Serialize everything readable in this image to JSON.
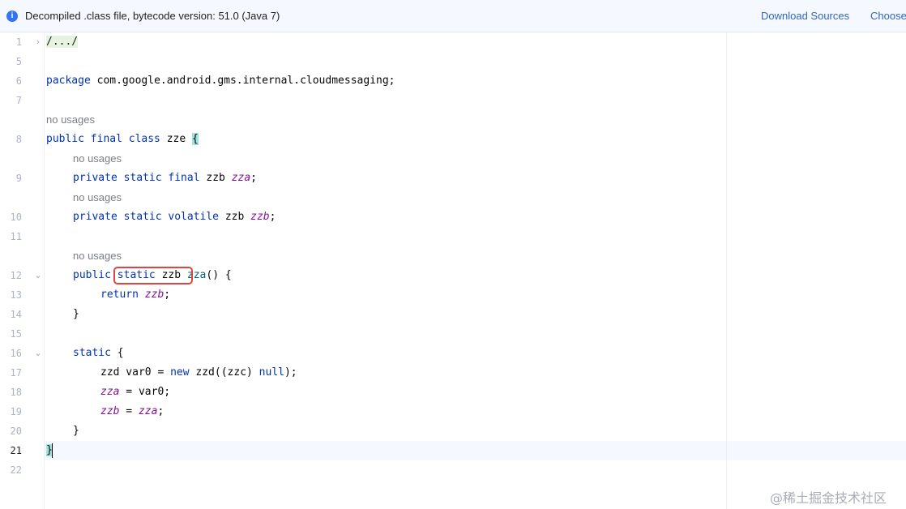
{
  "banner": {
    "icon": "info-icon",
    "message": "Decompiled .class file, bytecode version: 51.0 (Java 7)",
    "download_sources": "Download Sources",
    "choose_sources": "Choose"
  },
  "editor": {
    "line_numbers": [
      "1",
      "5",
      "6",
      "7",
      "8",
      "9",
      "10",
      "11",
      "12",
      "13",
      "14",
      "15",
      "16",
      "17",
      "18",
      "19",
      "20",
      "21",
      "22"
    ],
    "current_line": "21",
    "usage_hint": "no usages",
    "code": {
      "l1_folded": "/.../",
      "l6_kw": "package",
      "l6_rest": " com.google.android.gms.internal.cloudmessaging;",
      "l8_kw": "public final class",
      "l8_name": " zze ",
      "l8_brace": "{",
      "l9_kw": "private static final",
      "l9_type": " zzb ",
      "l9_field": "zza",
      "l9_end": ";",
      "l10_kw": "private static volatile",
      "l10_type": " zzb ",
      "l10_field": "zzb",
      "l10_end": ";",
      "l12_kw1": "public",
      "l12_kw2": "static",
      "l12_type": " zzb ",
      "l12_method": "zza",
      "l12_end": "() {",
      "l13_kw": "return",
      "l13_field": "zzb",
      "l13_end": ";",
      "l14": "}",
      "l16_kw": "static",
      "l16_end": " {",
      "l17_a": "zzd var0 = ",
      "l17_kw1": "new",
      "l17_b": " zzd((zzc) ",
      "l17_kw2": "null",
      "l17_c": ");",
      "l18_field": "zza",
      "l18_rest": " = var0;",
      "l19_field1": "zzb",
      "l19_mid": " = ",
      "l19_field2": "zza",
      "l19_end": ";",
      "l20": "}",
      "l21": "}"
    }
  },
  "watermark": "@稀土掘金技术社区",
  "colors": {
    "keyword": "#0033b3",
    "field": "#871094",
    "method": "#00627a",
    "highlight_box": "#e0443e",
    "link": "#2f65ca"
  }
}
